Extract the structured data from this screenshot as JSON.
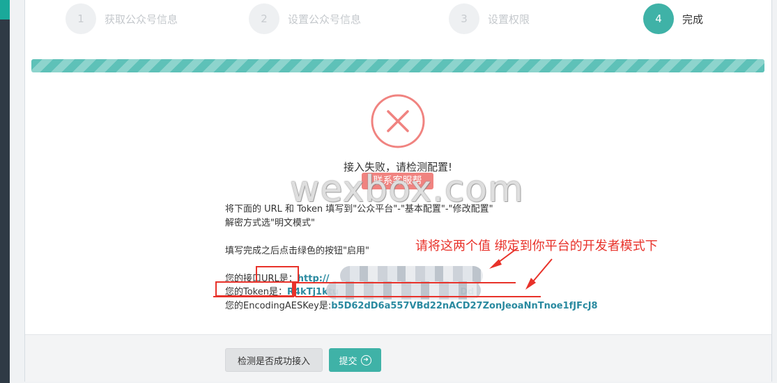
{
  "steps": [
    {
      "num": "1",
      "label": "获取公众号信息",
      "state": "done"
    },
    {
      "num": "2",
      "label": "设置公众号信息",
      "state": "done"
    },
    {
      "num": "3",
      "label": "设置权限",
      "state": "done"
    },
    {
      "num": "4",
      "label": "完成",
      "state": "active"
    }
  ],
  "progress": {
    "percent": 100
  },
  "status": {
    "message": "接入失败，请检测配置!",
    "help_label": "联系客服帮"
  },
  "watermark": "wexbox.com",
  "instructions": {
    "line1": "将下面的 URL 和 Token 填写到\"公众平台\"-\"基本配置\"-\"修改配置\"",
    "line2": "解密方式选\"明文模式\"",
    "line3": "填写完成之后点击绿色的按钮\"启用\"",
    "url_label": "您的接口URL是：",
    "url_value": "http://",
    "token_label": "您的Token是：",
    "token_value_start": "R4kTj1ktu",
    "token_value_end": "Dd",
    "aes_label": "您的EncodingAESKey是:",
    "aes_value": "b5D62dD6a557VBd22nACD27ZonJeoaNnTnoe1fJFcJ8"
  },
  "annotation": "请将这两个值 绑定到你平台的开发者模式下",
  "buttons": {
    "check": "检测是否成功接入",
    "submit": "提交"
  },
  "colors": {
    "accent": "#3fb2a7",
    "error": "#f08380",
    "annotation": "#e8322a",
    "value": "#2a8aa0"
  }
}
